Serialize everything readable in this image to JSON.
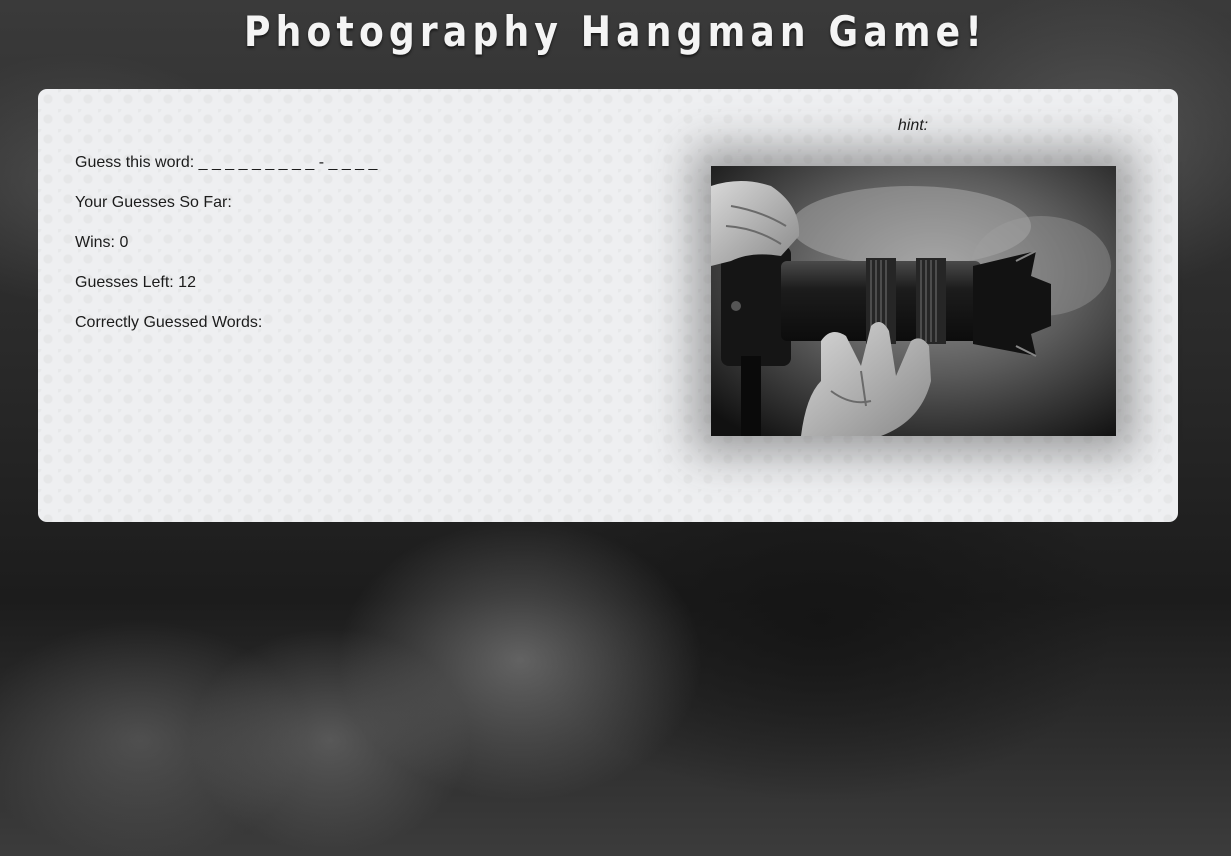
{
  "header": {
    "title": "Photography Hangman Game!"
  },
  "game": {
    "guess_label": "Guess this word:",
    "word_display": "_ _ _ _ _ _ _ _ _ - _ _ _ _",
    "guesses_label": "Your Guesses So Far:",
    "guesses_value": "",
    "wins_label": "Wins:",
    "wins_value": "0",
    "guesses_left_label": "Guesses Left:",
    "guesses_left_value": "12",
    "correct_words_label": "Correctly Guessed Words:",
    "correct_words_value": ""
  },
  "hint": {
    "label": "hint:",
    "value": ""
  },
  "image": {
    "subject": "hands-holding-camera-with-telephoto-lens"
  }
}
